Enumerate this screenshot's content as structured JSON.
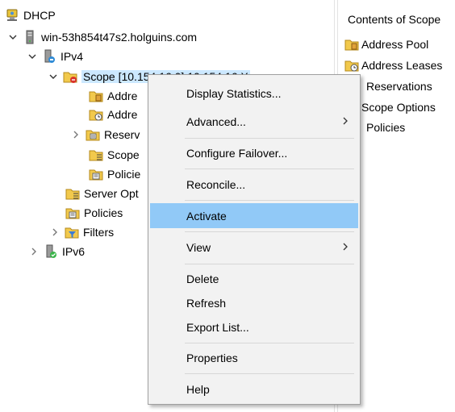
{
  "tree": {
    "root_label": "DHCP",
    "server_label": "win-53h854t47s2.holguins.com",
    "ipv4_label": "IPv4",
    "scope_label": "Scope [10.154.16.0] 10.154.16.X",
    "address_pool_label": "Addre",
    "address_leases_label": "Addre",
    "reservations_label": "Reserv",
    "scope_options_label": "Scope",
    "policies_child_label": "Policie",
    "server_options_label": "Server Opt",
    "policies_label": "Policies",
    "filters_label": "Filters",
    "ipv6_label": "IPv6"
  },
  "contents": {
    "header": "Contents of Scope",
    "items": [
      "Address Pool",
      "Address Leases",
      "Reservations",
      "Scope Options",
      "Policies"
    ]
  },
  "context_menu": {
    "items": [
      {
        "label": "Display Statistics..."
      },
      {
        "label": "Advanced..."
      },
      {
        "label": "Configure Failover..."
      },
      {
        "label": "Reconcile..."
      },
      {
        "label": "Activate"
      },
      {
        "label": "View"
      },
      {
        "label": "Delete"
      },
      {
        "label": "Refresh"
      },
      {
        "label": "Export List..."
      },
      {
        "label": "Properties"
      },
      {
        "label": "Help"
      }
    ],
    "highlighted": "Activate"
  },
  "colors": {
    "menu_bg": "#f2f2f2",
    "highlight": "#91c9f7",
    "selection": "#cce8ff"
  }
}
